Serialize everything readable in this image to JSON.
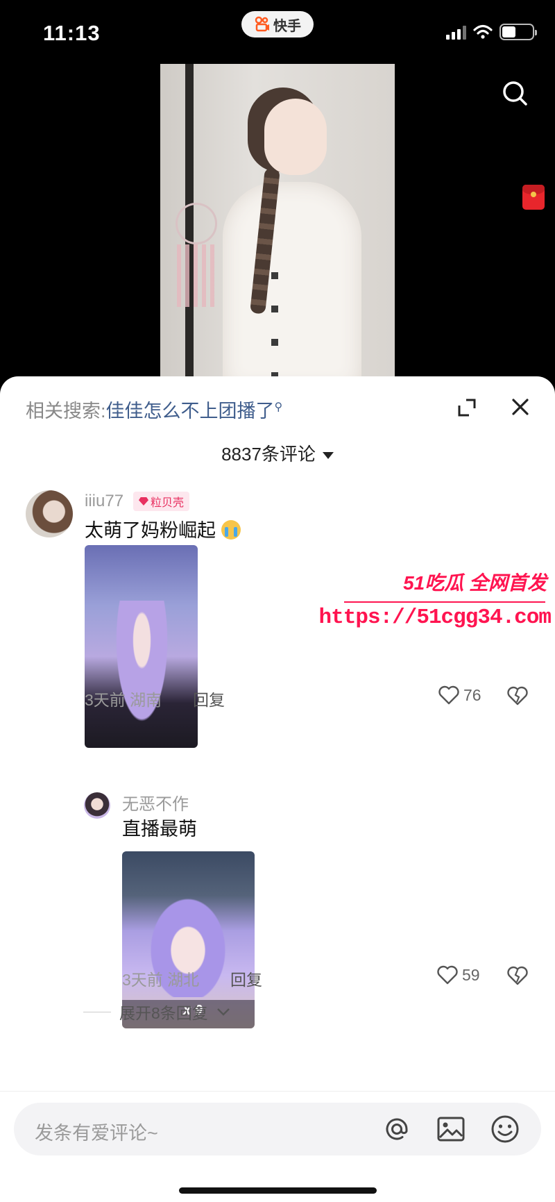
{
  "status_bar": {
    "time": "11:13",
    "app_name": "快手"
  },
  "video": {
    "search_icon": "search-icon",
    "redpacket_icon": "red-packet-icon"
  },
  "comments_panel": {
    "related_label": "相关搜索:",
    "related_keyword": "佳佳怎么不上团播了",
    "comment_count": "8837条评论",
    "comments": [
      {
        "username": "iiiu77",
        "badge": "粒贝壳",
        "text": "太萌了妈粉崛起",
        "time_location": "3天前 湖南",
        "reply_label": "回复",
        "likes": "76"
      },
      {
        "username": "无恶不作",
        "text": "直播最萌",
        "time_location": "3天前 湖北",
        "reply_label": "回复",
        "likes": "59",
        "overlay_count": "x 9"
      }
    ],
    "expand_replies": "展开8条回复"
  },
  "watermark": {
    "brand": "51吃瓜 全网首发",
    "url": "https://51cgg34.com"
  },
  "input": {
    "placeholder": "发条有爱评论~"
  },
  "colors": {
    "accent_link": "#3f5d8c",
    "watermark": "#ff1450",
    "badge": "#e83060"
  }
}
